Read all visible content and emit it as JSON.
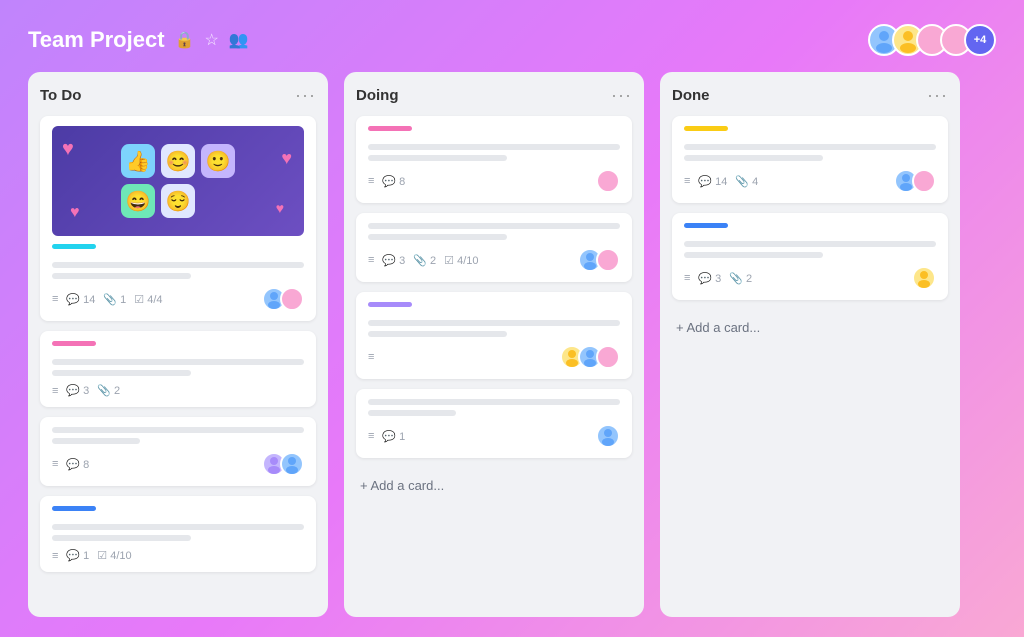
{
  "header": {
    "title": "Team Project",
    "icons": [
      "🔒",
      "☆",
      "👥"
    ],
    "avatarCount": "+4"
  },
  "columns": [
    {
      "id": "todo",
      "title": "To Do",
      "menuLabel": "···",
      "cards": [
        {
          "id": "todo-1",
          "hasImage": true,
          "tag": "cyan",
          "meta": [
            "≡",
            "💬 14",
            "📎 1",
            "☑ 4/4"
          ],
          "avatars": [
            "blue",
            "pink"
          ]
        },
        {
          "id": "todo-2",
          "tag": "pink",
          "meta": [
            "≡",
            "💬 3",
            "📎 2"
          ],
          "avatars": []
        },
        {
          "id": "todo-3",
          "tag": null,
          "meta": [
            "≡",
            "💬 8"
          ],
          "avatars": [
            "purple",
            "blue"
          ]
        },
        {
          "id": "todo-4",
          "tag": "blue",
          "meta": [
            "≡",
            "💬 1",
            "☑ 4/10"
          ],
          "avatars": []
        }
      ],
      "addLabel": "+ Add a card..."
    },
    {
      "id": "doing",
      "title": "Doing",
      "menuLabel": "···",
      "cards": [
        {
          "id": "doing-1",
          "tag": "pink",
          "meta": [
            "≡",
            "💬 8"
          ],
          "avatars": [
            "pink"
          ]
        },
        {
          "id": "doing-2",
          "tag": null,
          "meta": [
            "≡",
            "💬 3",
            "📎 2",
            "☑ 4/10"
          ],
          "avatars": [
            "blue",
            "pink"
          ]
        },
        {
          "id": "doing-3",
          "tag": "purple",
          "meta": [
            "≡"
          ],
          "avatars": [
            "yellow",
            "blue",
            "pink"
          ]
        },
        {
          "id": "doing-4",
          "tag": null,
          "meta": [
            "≡",
            "💬 1"
          ],
          "avatars": [
            "blue"
          ]
        }
      ],
      "addLabel": "+ Add a card..."
    },
    {
      "id": "done",
      "title": "Done",
      "menuLabel": "···",
      "cards": [
        {
          "id": "done-1",
          "tag": "yellow",
          "meta": [
            "≡",
            "💬 14",
            "📎 4"
          ],
          "avatars": [
            "blue",
            "pink"
          ]
        },
        {
          "id": "done-2",
          "tag": "blue",
          "meta": [
            "≡",
            "💬 3",
            "📎 2"
          ],
          "avatars": [
            "yellow"
          ]
        }
      ],
      "addLabel": "+ Add a card..."
    }
  ]
}
